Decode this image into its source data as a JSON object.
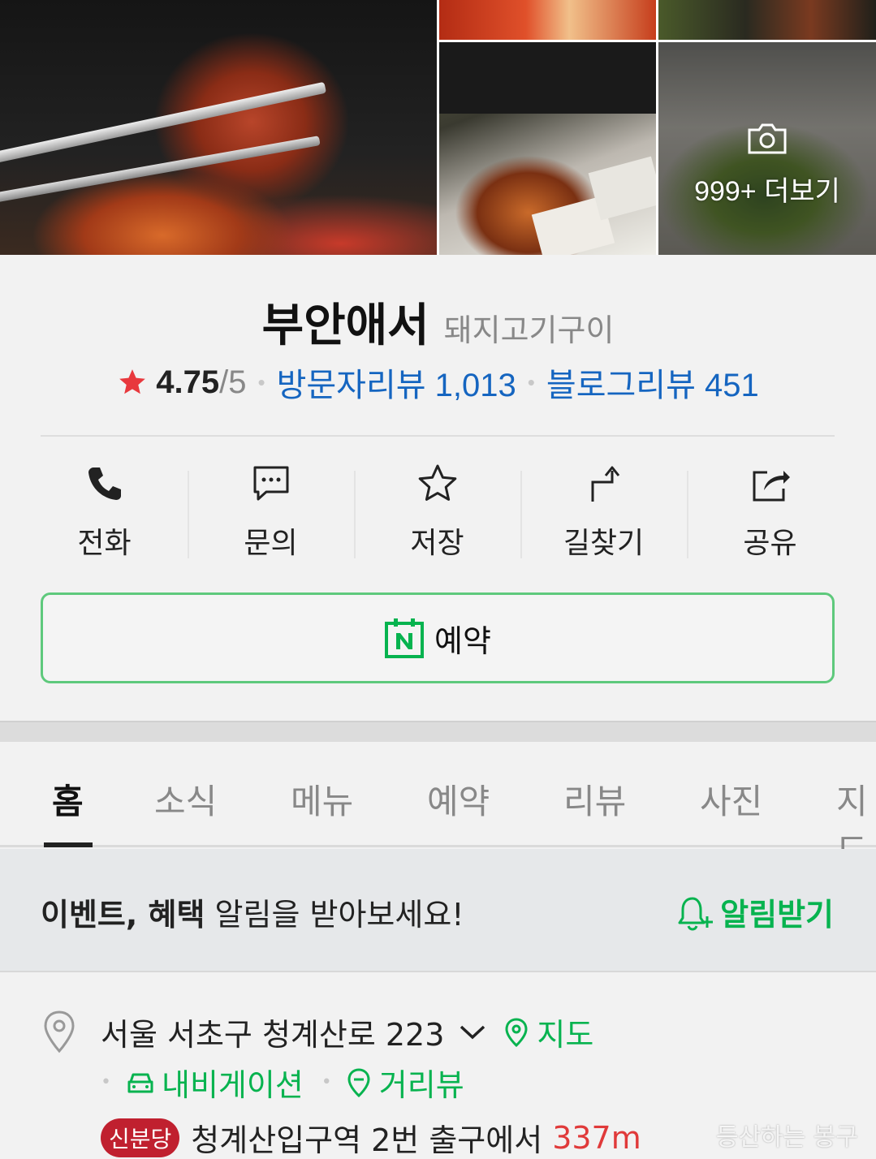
{
  "gallery": {
    "more_label": "999+ 더보기"
  },
  "place": {
    "name": "부안애서",
    "category": "돼지고기구이"
  },
  "rating": {
    "score": "4.75",
    "max": "/5",
    "visitor_review_label": "방문자리뷰 1,013",
    "blog_review_label": "블로그리뷰 451",
    "star_color": "#e8383d"
  },
  "actions": [
    {
      "label": "전화",
      "icon": "phone-icon"
    },
    {
      "label": "문의",
      "icon": "chat-icon"
    },
    {
      "label": "저장",
      "icon": "star-outline-icon"
    },
    {
      "label": "길찾기",
      "icon": "directions-icon"
    },
    {
      "label": "공유",
      "icon": "share-icon"
    }
  ],
  "reserve": {
    "label": "예약",
    "accent": "#07b34f"
  },
  "tabs": [
    "홈",
    "소식",
    "메뉴",
    "예약",
    "리뷰",
    "사진",
    "지도"
  ],
  "active_tab": "홈",
  "notify": {
    "bold_text": "이벤트, 혜택",
    "text": " 알림을 받아보세요!",
    "button_label": "알림받기"
  },
  "address": {
    "text": "서울 서초구 청계산로 223",
    "map_label": "지도",
    "navigation_label": "내비게이션",
    "streetview_label": "거리뷰",
    "subway_line": "신분당",
    "station_text": "청계산입구역 2번 출구에서",
    "distance": "337m"
  },
  "watermark": "등산하는 봉구"
}
